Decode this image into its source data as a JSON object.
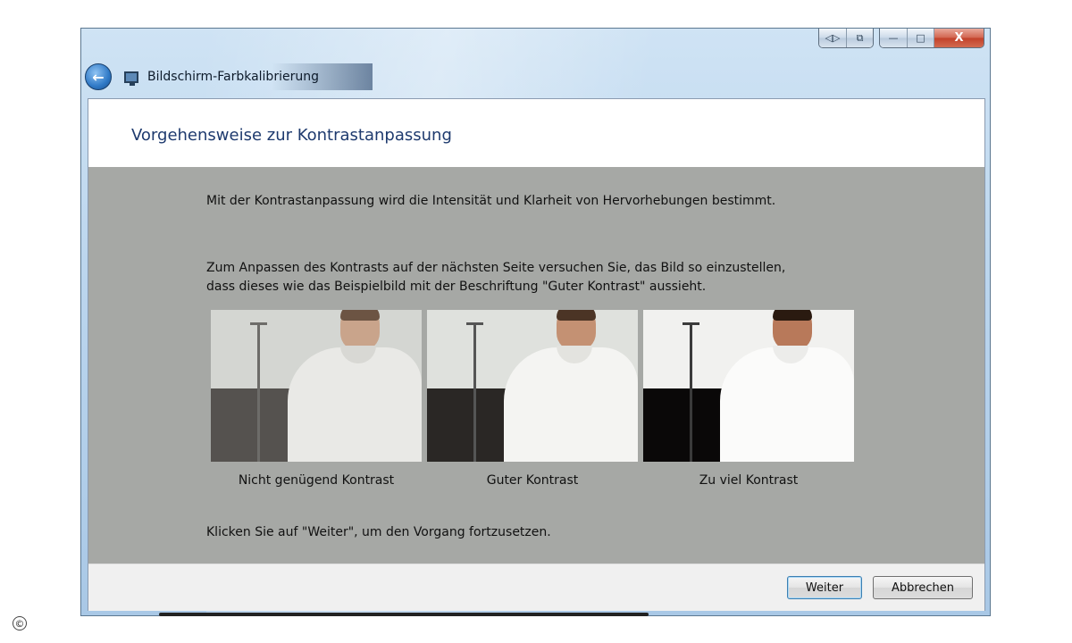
{
  "window": {
    "title": "Bildschirm-Farbkalibrierung",
    "caption_buttons": {
      "extra1": "◁▷",
      "extra2": "⧉",
      "minimize": "—",
      "maximize": "□",
      "close": "X"
    }
  },
  "page": {
    "heading": "Vorgehensweise zur Kontrastanpassung",
    "intro": "Mit der Kontrastanpassung wird die Intensität und Klarheit von Hervorhebungen bestimmt.",
    "instruction_line1": "Zum Anpassen des Kontrasts auf der nächsten Seite versuchen Sie, das Bild so einzustellen,",
    "instruction_line2": "dass dieses wie das Beispielbild mit der Beschriftung \"Guter Kontrast\" aussieht.",
    "samples": [
      {
        "caption": "Nicht genügend Kontrast"
      },
      {
        "caption": "Guter Kontrast"
      },
      {
        "caption": "Zu viel Kontrast"
      }
    ],
    "continue_hint": "Klicken Sie auf \"Weiter\", um den Vorgang fortzusetzen."
  },
  "footer": {
    "next_label": "Weiter",
    "cancel_label": "Abbrechen"
  },
  "copyright_symbol": "©",
  "icons": [
    "back-arrow-icon",
    "display-calibration-icon"
  ]
}
